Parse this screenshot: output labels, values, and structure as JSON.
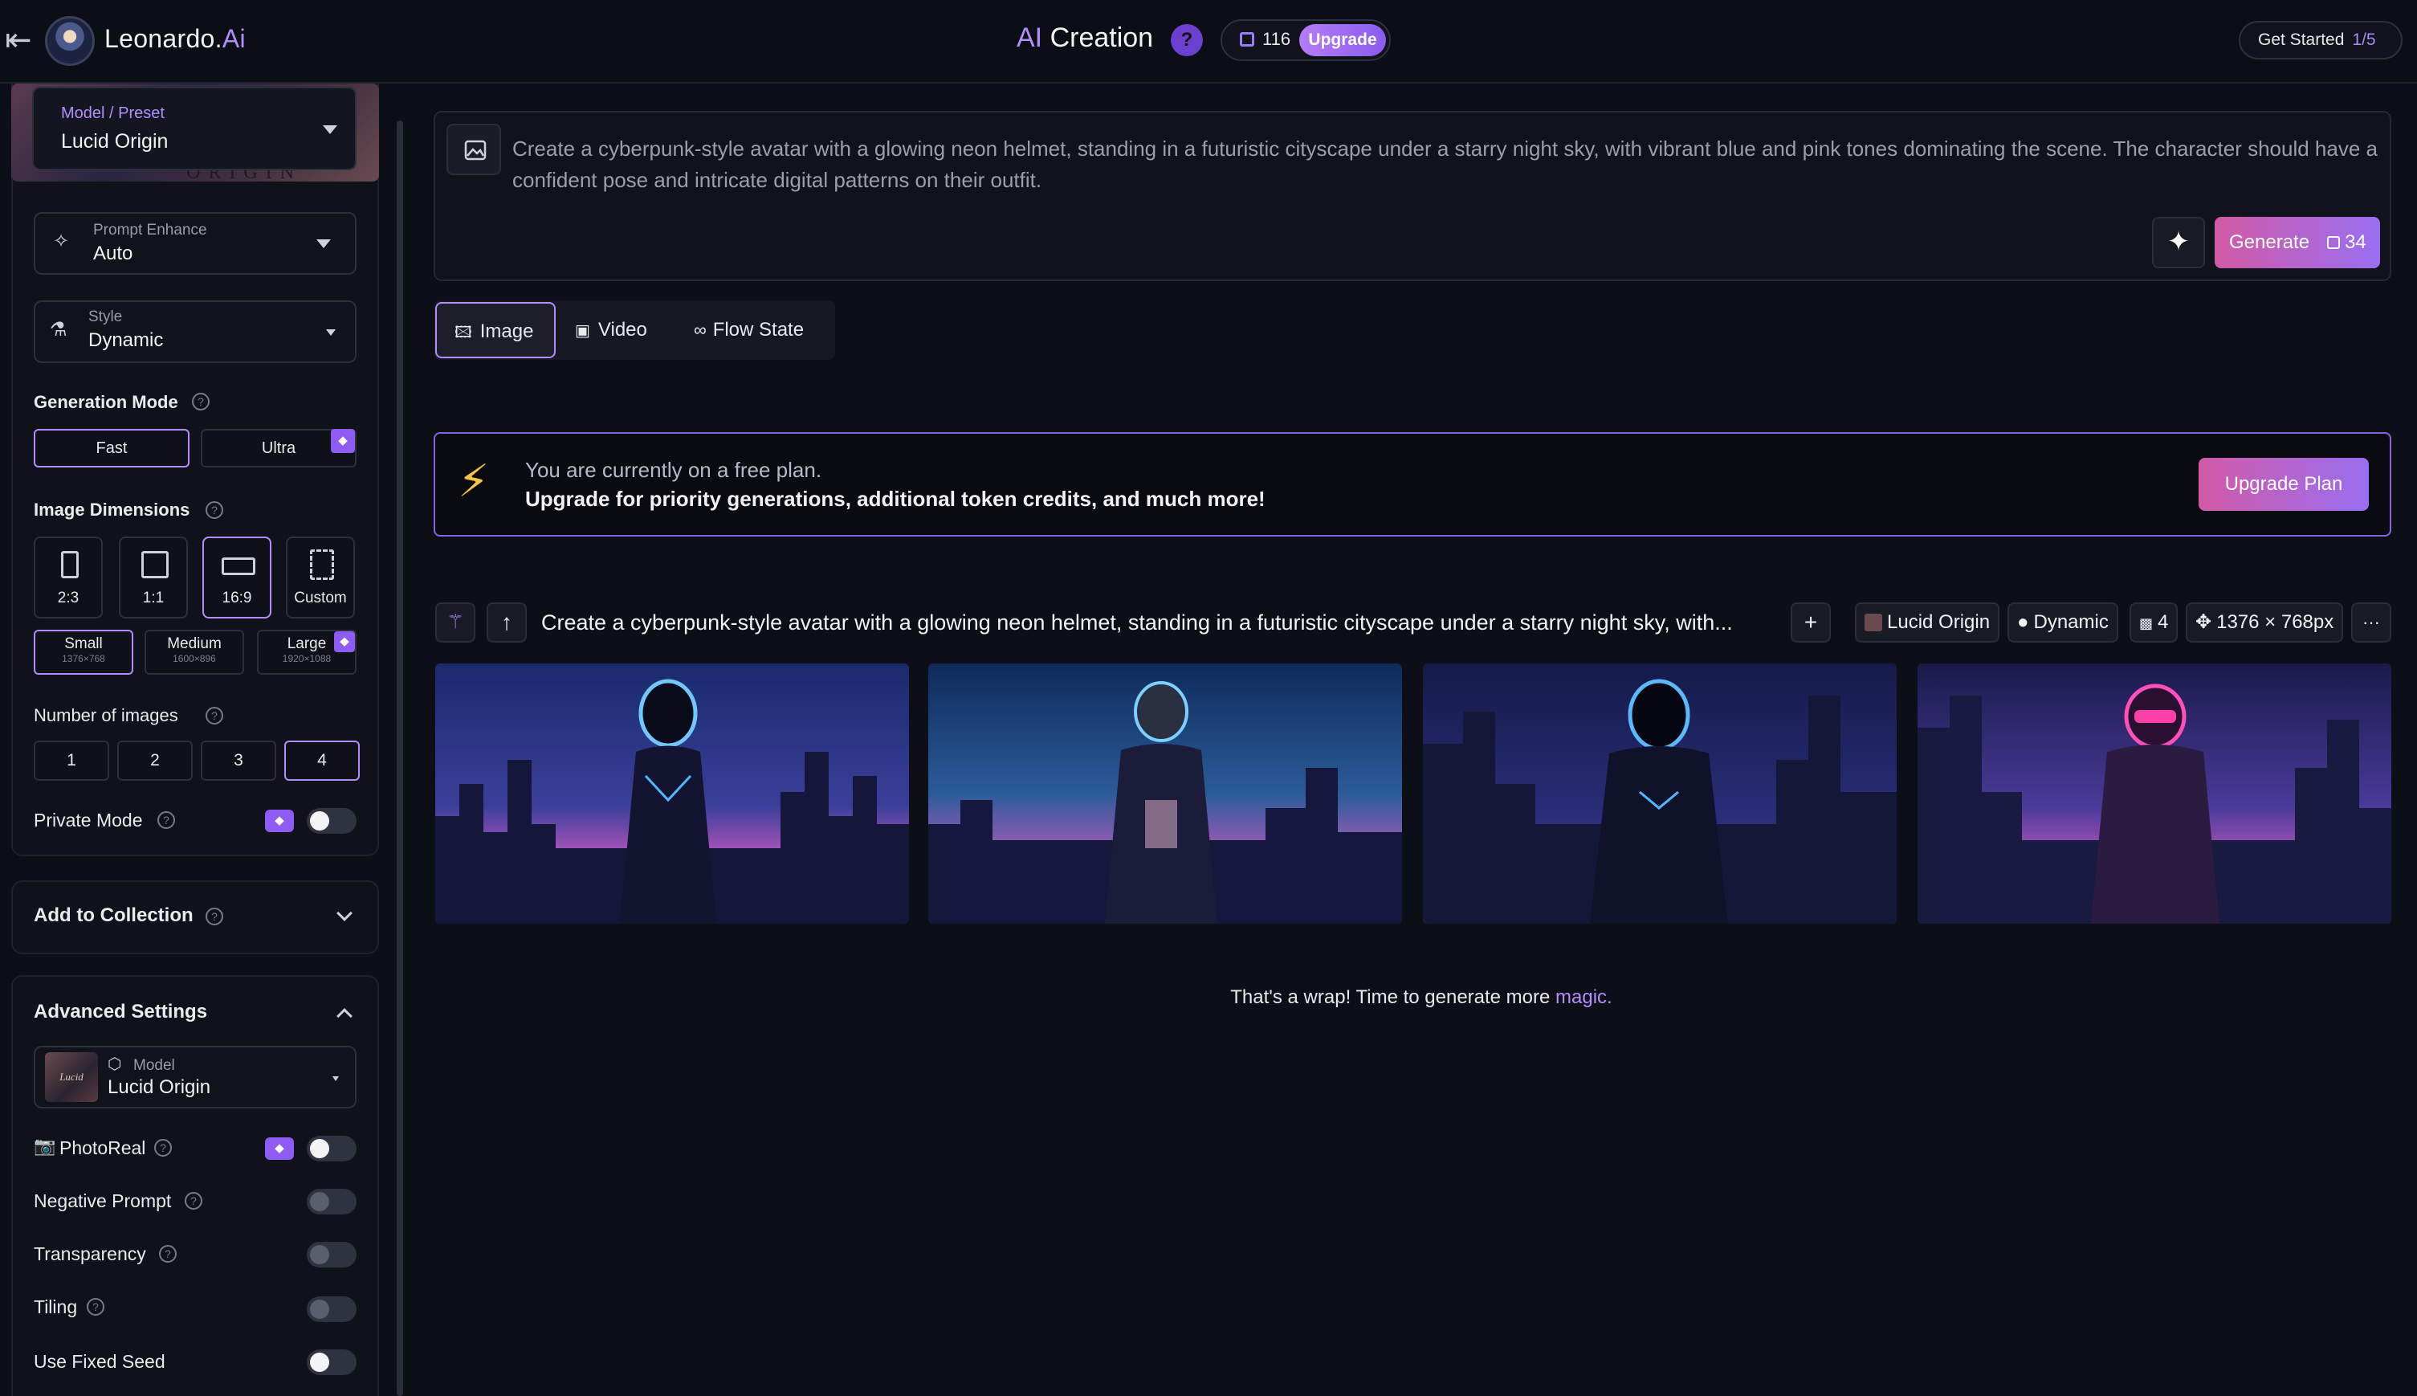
{
  "header": {
    "brand_name": "Leonardo.",
    "brand_suffix": "Ai",
    "title_prefix": "AI",
    "title_rest": " Creation",
    "help": "?",
    "tokens": "116",
    "upgrade": "Upgrade",
    "get_started": "Get Started",
    "get_started_progress": "1/5"
  },
  "sidebar": {
    "model_preset_label": "Model / Preset",
    "model_preset_value": "Lucid Origin",
    "model_banner_text": "ORIGIN",
    "prompt_enhance_label": "Prompt Enhance",
    "prompt_enhance_value": "Auto",
    "style_label": "Style",
    "style_value": "Dynamic",
    "generation_mode_title": "Generation Mode",
    "generation_modes": [
      "Fast",
      "Ultra"
    ],
    "image_dimensions_title": "Image Dimensions",
    "aspect_ratios": [
      "2:3",
      "1:1",
      "16:9",
      "Custom"
    ],
    "sizes": [
      {
        "name": "Small",
        "res": "1376×768"
      },
      {
        "name": "Medium",
        "res": "1600×896"
      },
      {
        "name": "Large",
        "res": "1920×1088"
      }
    ],
    "number_of_images_title": "Number of images",
    "image_counts": [
      "1",
      "2",
      "3",
      "4"
    ],
    "private_mode": "Private Mode",
    "add_to_collection": "Add to Collection",
    "advanced_settings": "Advanced Settings",
    "adv_model_label": "Model",
    "adv_model_value": "Lucid Origin",
    "adv_model_thumb_text": "Lucid",
    "photoreal": "PhotoReal",
    "negative_prompt": "Negative Prompt",
    "transparency": "Transparency",
    "tiling": "Tiling",
    "use_fixed_seed": "Use Fixed Seed"
  },
  "main": {
    "prompt": "Create a cyberpunk-style avatar with a glowing neon helmet, standing in a futuristic cityscape under a starry night sky, with vibrant blue and pink tones dominating the scene. The character should have a confident pose and intricate digital patterns on their outfit.",
    "generate_label": "Generate",
    "generate_cost": "34",
    "tabs": [
      "Image",
      "Video",
      "Flow State"
    ],
    "banner_line1": "You are currently on a free plan.",
    "banner_line2": "Upgrade for priority generations, additional token credits, and much more!",
    "upgrade_plan": "Upgrade Plan",
    "history_prompt": "Create a cyberpunk-style avatar with a glowing neon helmet, standing in a futuristic cityscape under a starry night sky, with...",
    "chips": {
      "model": "Lucid Origin",
      "style": "Dynamic",
      "count": "4",
      "dimensions": "1376 × 768px",
      "more": "···"
    },
    "wrap_text": "That's a wrap! Time to generate more ",
    "wrap_link": "magic."
  },
  "colors": {
    "accent": "#b58cff",
    "generate_gradient_start": "#d15aa6",
    "generate_gradient_end": "#9a6ef2",
    "background": "#0d0f17"
  },
  "icons": [
    "back-arrow-icon",
    "help-icon",
    "token-icon",
    "chevron-down-icon",
    "sparkle-icon",
    "style-icon",
    "gem-icon",
    "image-icon",
    "video-icon",
    "flow-state-icon",
    "lightning-icon",
    "magic-wand-icon",
    "upload-arrow-icon",
    "plus-icon",
    "droplet-icon",
    "images-count-icon",
    "move-icon",
    "more-icon",
    "cube-icon",
    "camera-icon",
    "chevron-up-icon"
  ]
}
